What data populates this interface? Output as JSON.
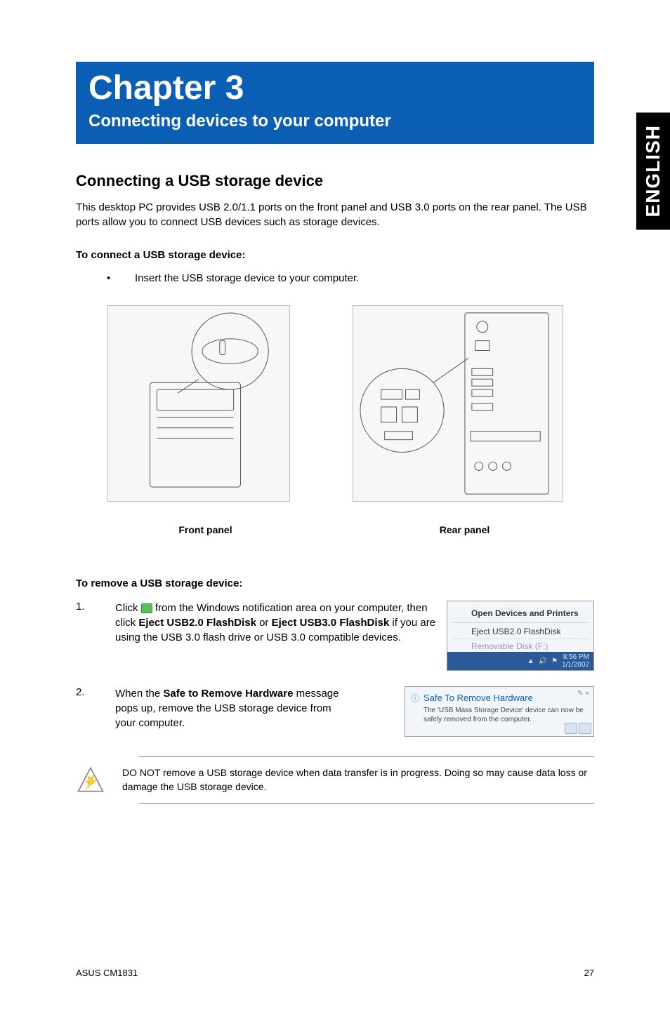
{
  "sidebar": {
    "language": "ENGLISH"
  },
  "chapter": {
    "title": "Chapter 3",
    "subtitle": "Connecting devices to your computer"
  },
  "section": {
    "heading": "Connecting a USB storage device",
    "intro": "This desktop PC provides USB 2.0/1.1 ports on the front panel and USB 3.0 ports on the rear panel. The USB ports allow you to connect USB devices such as storage devices.",
    "connect_heading": "To connect a USB storage device:",
    "connect_step": "Insert the USB storage device to your computer.",
    "front_label": "Front panel",
    "rear_label": "Rear panel",
    "remove_heading": "To remove a USB storage device:"
  },
  "steps": {
    "s1_num": "1.",
    "s1_a": "Click ",
    "s1_b": " from the Windows notification area on your computer, then click ",
    "s1_bold1": "Eject USB2.0 FlashDisk",
    "s1_c": " or ",
    "s1_bold2": "Eject USB3.0 FlashDisk",
    "s1_d": " if you are using the USB 3.0 flash drive or USB 3.0 compatible devices.",
    "s2_num": "2.",
    "s2_a": "When the ",
    "s2_bold": "Safe to Remove Hardware",
    "s2_b": " message pops up, remove the USB storage device from your computer."
  },
  "screenshot1": {
    "header": "Open Devices and Printers",
    "item": "Eject USB2.0 FlashDisk",
    "disabled": "Removable Disk (F:)",
    "time": "8:56 PM",
    "date": "1/1/2002"
  },
  "screenshot2": {
    "title": "Safe To Remove Hardware",
    "body": "The 'USB Mass Storage Device' device can now be safely removed from the computer.",
    "corner": "✎ ×"
  },
  "warning": {
    "text": "DO NOT remove a USB storage device when data transfer is in progress. Doing so may cause data loss or damage the USB storage device."
  },
  "footer": {
    "model": "ASUS CM1831",
    "page": "27"
  }
}
